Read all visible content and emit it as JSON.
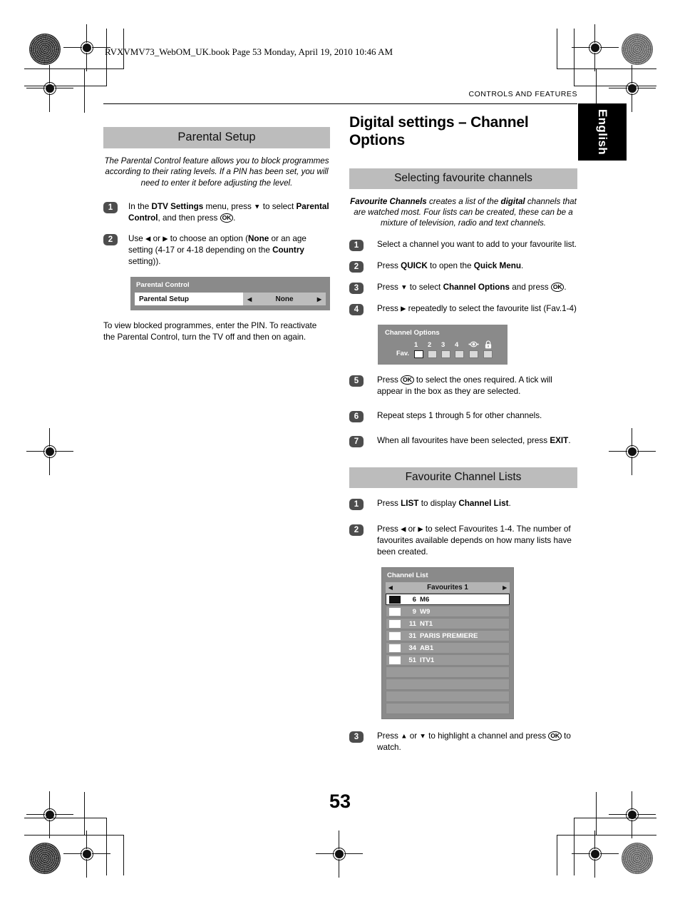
{
  "header": {
    "file_line": "RVXVMV73_WebOM_UK.book  Page 53  Monday, April 19, 2010  10:46 AM",
    "running_head": "CONTROLS AND FEATURES",
    "language_tab": "English"
  },
  "page_number": "53",
  "left_column": {
    "section_title": "Parental Setup",
    "lede": "The Parental Control feature allows you to block programmes according to their rating levels. If a PIN has been set, you will need to enter it before adjusting the level.",
    "steps": [
      {
        "n": "1",
        "html": "In the <b>DTV Settings</b> menu, press <span class=\"arr\">▼</span> to select <b>Parental Control</b>, and then press <span class=\"okkey\">OK</span>."
      },
      {
        "n": "2",
        "html": "Use <span class=\"arr\">◀</span> or <span class=\"arr\">▶</span> to choose an option (<b>None</b> or an age setting (4-17 or 4-18 depending on the <b>Country</b> setting))."
      }
    ],
    "osd_parental": {
      "title": "Parental Control",
      "row_label": "Parental Setup",
      "row_value": "None",
      "left_arrow": "◀",
      "right_arrow": "▶"
    },
    "note": "To view blocked programmes, enter the PIN. To reactivate the Parental Control, turn the TV off and then on again."
  },
  "right_column": {
    "page_title": "Digital settings – Channel Options",
    "section_one": {
      "bar_title": "Selecting favourite channels",
      "lede": "<b>Favourite Channels</b> creates a list of the <b>digital</b> channels that are watched most. Four lists can be created, these can be a mixture of television, radio and text channels.",
      "steps": [
        {
          "n": "1",
          "html": "Select a channel you want to add to your favourite list."
        },
        {
          "n": "2",
          "html": "Press <b>QUICK</b> to open the <b>Quick Menu</b>."
        },
        {
          "n": "3",
          "html": "Press <span class=\"arr\">▼</span> to select <b>Channel Options</b> and press <span class=\"okkey\">OK</span>."
        },
        {
          "n": "4",
          "html": "Press <span class=\"arr\">▶</span> repeatedly to select the favourite list (Fav.1-4)"
        },
        {
          "n": "5",
          "html": "Press <span class=\"okkey\">OK</span> to select the ones required. A tick will appear in the box as they are selected."
        },
        {
          "n": "6",
          "html": "Repeat steps 1 through 5 for other channels."
        },
        {
          "n": "7",
          "html": "When all favourites have been selected, press <b>EXIT</b>."
        }
      ],
      "osd_channel_options": {
        "title": "Channel Options",
        "fav_label": "Fav.",
        "columns": [
          {
            "label": "1",
            "icon": "",
            "selected": true
          },
          {
            "label": "2",
            "icon": "",
            "selected": false
          },
          {
            "label": "3",
            "icon": "",
            "selected": false
          },
          {
            "label": "4",
            "icon": "",
            "selected": false
          },
          {
            "label": "",
            "icon": "skip-eye-icon",
            "selected": false
          },
          {
            "label": "",
            "icon": "padlock-icon",
            "selected": false
          }
        ]
      }
    },
    "section_two": {
      "bar_title": "Favourite Channel Lists",
      "steps": [
        {
          "n": "1",
          "html": "Press <b>LIST</b> to display <b>Channel List</b>."
        },
        {
          "n": "2",
          "html": "Press <span class=\"arr\">◀</span> or <span class=\"arr\">▶</span> to select Favourites 1-4. The number of favourites available depends on how many lists have been created."
        },
        {
          "n": "3",
          "html": "Press <span class=\"arr\">▲</span> or <span class=\"arr\">▼</span> to highlight a channel and press <span class=\"okkey\">OK</span> to watch."
        }
      ],
      "osd_channel_list": {
        "title": "Channel List",
        "fav_bar": "Favourites 1",
        "left_arrow": "◀",
        "right_arrow": "▶",
        "rows": [
          {
            "num": "6",
            "name": "M6",
            "active": true
          },
          {
            "num": "9",
            "name": "W9",
            "active": false
          },
          {
            "num": "11",
            "name": "NT1",
            "active": false
          },
          {
            "num": "31",
            "name": "PARIS PREMIERE",
            "active": false
          },
          {
            "num": "34",
            "name": "AB1",
            "active": false
          },
          {
            "num": "51",
            "name": "ITV1",
            "active": false
          }
        ],
        "blank_rows": 4
      }
    }
  },
  "colors": {
    "section_bar": "#bcbcbc",
    "osd_background": "#8a8a8a",
    "badge": "#4d4d4d",
    "language_tab": "#000000"
  }
}
